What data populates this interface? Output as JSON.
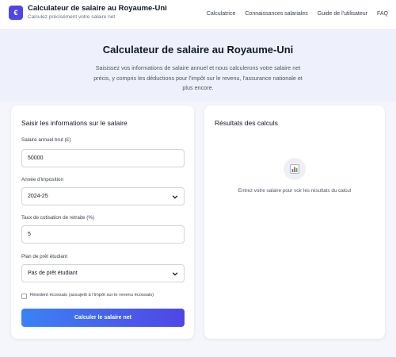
{
  "header": {
    "logo_glyph": "€",
    "title": "Calculateur de salaire au Royaume-Uni",
    "subtitle": "Calculez précisément votre salaire net",
    "nav": [
      {
        "label": "Calculatrice"
      },
      {
        "label": "Connaissances salariales"
      },
      {
        "label": "Guide de l'utilisateur"
      },
      {
        "label": "FAQ"
      }
    ]
  },
  "hero": {
    "title": "Calculateur de salaire au Royaume-Uni",
    "description": "Saisissez vos informations de salaire annuel et nous calculerons votre salaire net précis, y compris les déductions pour l'impôt sur le revenu, l'assurance nationale et plus encore."
  },
  "form": {
    "title": "Saisir les informations sur le salaire",
    "salary_label": "Salaire annuel brut (£)",
    "salary_value": "50000",
    "tax_year_label": "Année d'imposition",
    "tax_year_value": "2024-25",
    "pension_label": "Taux de cotisation de retraite (%)",
    "pension_value": "5",
    "student_loan_label": "Plan de prêt étudiant",
    "student_loan_value": "Pas de prêt étudiant",
    "scottish_label": "Résident écossais (assujetti à l'impôt sur le revenu écossais)",
    "scottish_checked": false,
    "submit_label": "Calculer le salaire net"
  },
  "results": {
    "title": "Résultats des calculs",
    "icon": "bar-chart-icon",
    "empty_message": "Entrez votre salaire pour voir les résultats du calcul"
  },
  "colors": {
    "accent": "#4f46e5",
    "button_gradient_start": "#3b82f6",
    "button_gradient_end": "#4f46e5",
    "page_background": "#f4f6fb"
  }
}
